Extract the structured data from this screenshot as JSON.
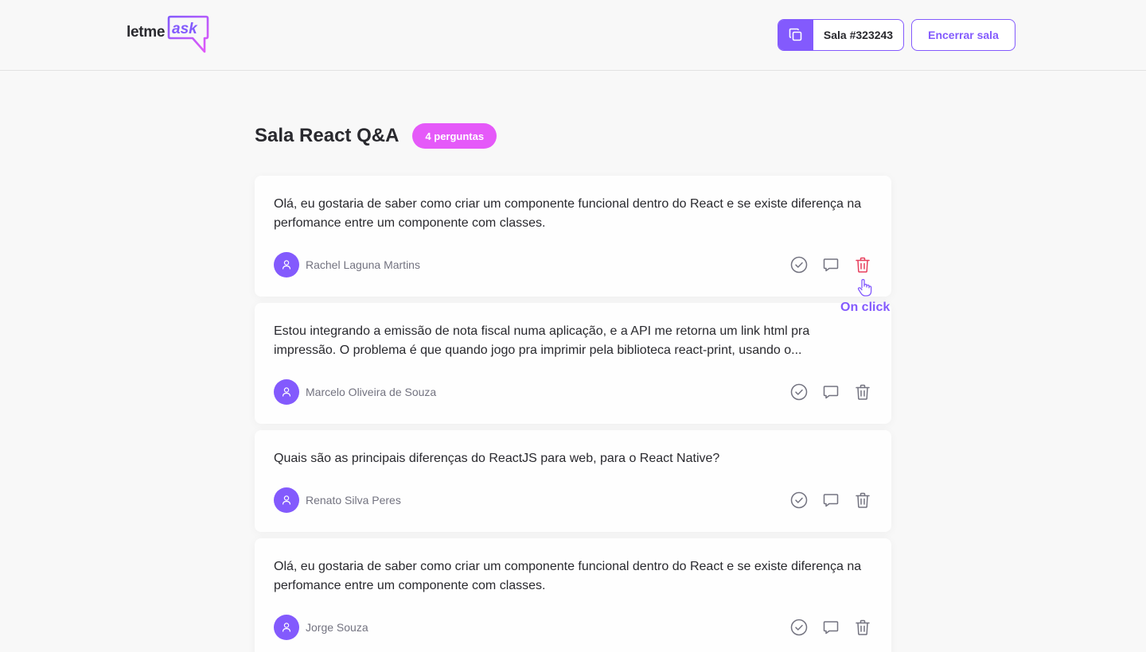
{
  "header": {
    "logo": {
      "word": "letme",
      "accent": "ask"
    },
    "room_code_label": "Sala #323243",
    "close_room_label": "Encerrar sala"
  },
  "page": {
    "title": "Sala React Q&A",
    "question_count_badge": "4 perguntas"
  },
  "questions": [
    {
      "content": "Olá, eu gostaria de saber como criar um componente funcional dentro do React e se existe diferença na perfomance entre um componente com classes.",
      "author": "Rachel Laguna Martins",
      "delete_highlighted": true
    },
    {
      "content": "Estou integrando a emissão de nota fiscal numa aplicação, e a API me retorna um link html pra impressão. O problema é que quando jogo pra imprimir pela biblioteca react-print, usando o...",
      "author": "Marcelo Oliveira de Souza",
      "delete_highlighted": false
    },
    {
      "content": "Quais são as principais diferenças do ReactJS para web, para o React Native?",
      "author": "Renato Silva Peres",
      "delete_highlighted": false
    },
    {
      "content": "Olá, eu gostaria de saber como criar um componente funcional dentro do React e se existe diferença na perfomance entre um componente com classes.",
      "author": "Jorge Souza",
      "delete_highlighted": false
    }
  ],
  "annotation": {
    "label": "On click"
  },
  "icons": {
    "copy": "copy-icon",
    "check": "check-circle-icon",
    "answer": "chat-bubble-icon",
    "delete": "trash-icon",
    "user": "user-icon",
    "pointer": "hand-pointer-icon"
  },
  "colors": {
    "primary": "#835afd",
    "badge": "#e559f9",
    "danger": "#e73f5d",
    "background": "#f8f8f8",
    "icon_gray": "#737380"
  }
}
